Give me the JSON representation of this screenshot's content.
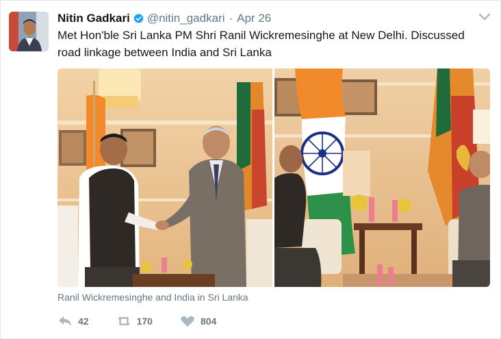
{
  "tweet": {
    "author_name": "Nitin Gadkari",
    "handle": "@nitin_gadkari",
    "separator": "·",
    "date": "Apr 26",
    "text": "Met Hon'ble Sri Lanka PM Shri Ranil Wickremesinghe at New Delhi. Discussed road linkage between India and Sri Lanka",
    "media_caption": "Ranil Wickremesinghe and India in Sri Lanka",
    "replies": "42",
    "retweets": "170",
    "likes": "804"
  },
  "icons": {
    "verified": "verified-badge-icon",
    "caret": "chevron-down-icon",
    "reply": "reply-icon",
    "retweet": "retweet-icon",
    "like": "heart-icon"
  },
  "colors": {
    "accent": "#1da1f2",
    "secondary_text": "#657786",
    "primary_text": "#14171a"
  }
}
